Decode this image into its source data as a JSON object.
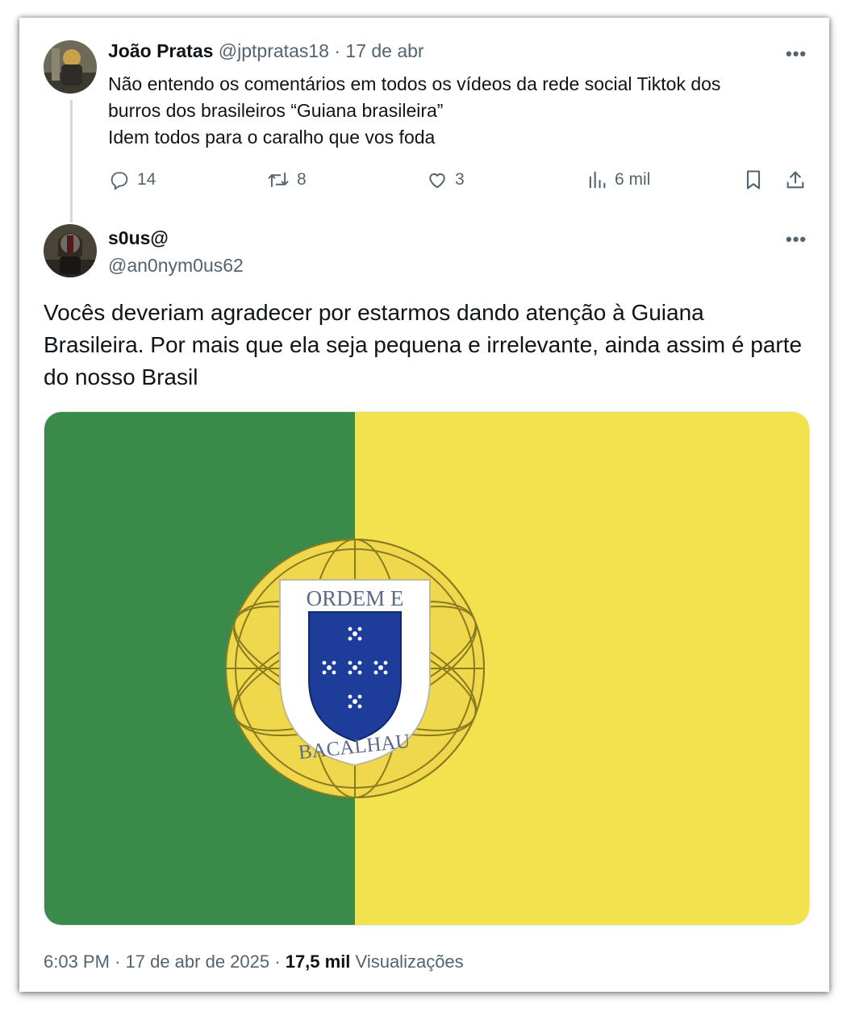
{
  "reply": {
    "author_name": "João Pratas",
    "author_handle": "@jptpratas18",
    "separator": "·",
    "date": "17 de abr",
    "more_label": "•••",
    "text_lines": [
      "Não entendo os comentários em todos os vídeos da rede social Tiktok dos",
      "burros dos brasileiros “Guiana brasileira”",
      "Idem todos para o caralho que vos foda"
    ],
    "actions": {
      "replies": "14",
      "reposts": "8",
      "likes": "3",
      "views": "6 mil"
    }
  },
  "post": {
    "author_name": "s0us@",
    "author_handle": "@an0nym0us62",
    "more_label": "•••",
    "text": "Vocês deveriam agradecer por estarmos dando atenção à Guiana Brasileira. Por mais que ela seja pequena e irrelevante, ainda assim é parte do nosso Brasil",
    "image": {
      "flag_colors": {
        "left": "#3a8a4a",
        "right": "#f2e34e"
      },
      "emblem_text_top": "ORDEM E",
      "emblem_text_bottom": "BACALHAU"
    },
    "footer": {
      "time": "6:03 PM",
      "separator": "·",
      "date": "17 de abr de 2025",
      "views_count": "17,5 mil",
      "views_label": "Visualizações"
    }
  }
}
